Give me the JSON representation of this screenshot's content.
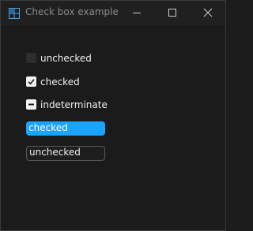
{
  "window": {
    "title": "Check box example",
    "icon": "grid-window-icon"
  },
  "controls": {
    "minimize_icon": "minimize-icon",
    "maximize_icon": "maximize-icon",
    "close_icon": "close-icon"
  },
  "checkboxes": [
    {
      "label": "unchecked",
      "state": "unchecked"
    },
    {
      "label": "checked",
      "state": "checked"
    },
    {
      "label": "indeterminate",
      "state": "indeterminate"
    }
  ],
  "toggle_buttons": [
    {
      "label": "checked",
      "state": "checked"
    },
    {
      "label": "unchecked",
      "state": "unchecked"
    }
  ],
  "colors": {
    "accent": "#1aa3ff",
    "background": "#1b1b1b",
    "titlebar": "#202020"
  }
}
